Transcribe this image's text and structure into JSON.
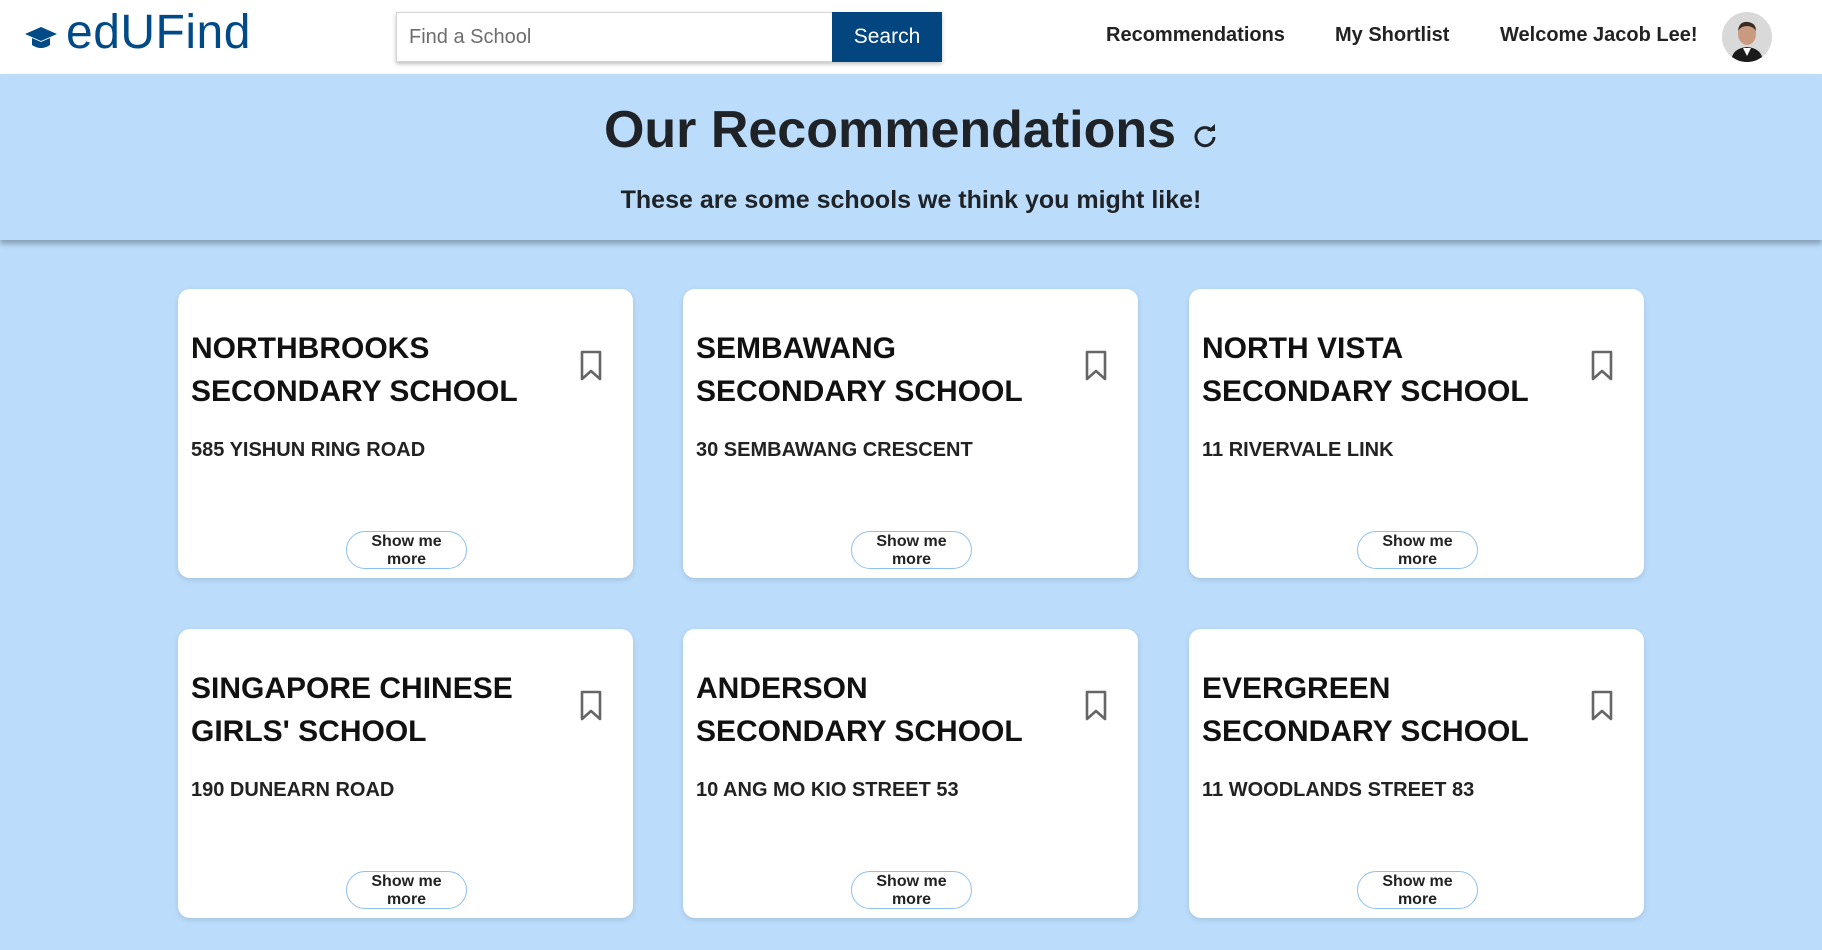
{
  "navbar": {
    "brand": "edUFind",
    "search": {
      "placeholder": "Find a School",
      "value": "",
      "button_label": "Search"
    },
    "links": {
      "recommendations": "Recommendations",
      "shortlist": "My Shortlist"
    },
    "welcome": "Welcome Jacob Lee!"
  },
  "hero": {
    "title": "Our Recommendations",
    "subtitle": "These are some schools we think you might like!"
  },
  "cards": [
    {
      "name": "NORTHBROOKS SECONDARY SCHOOL",
      "address": "585 YISHUN RING ROAD",
      "button": "Show me more"
    },
    {
      "name": "SEMBAWANG SECONDARY SCHOOL",
      "address": "30 SEMBAWANG CRESCENT",
      "button": "Show me more"
    },
    {
      "name": "NORTH VISTA SECONDARY SCHOOL",
      "address": "11 RIVERVALE LINK",
      "button": "Show me more"
    },
    {
      "name": "SINGAPORE CHINESE GIRLS' SCHOOL",
      "address": "190 DUNEARN ROAD",
      "button": "Show me more"
    },
    {
      "name": "ANDERSON SECONDARY SCHOOL",
      "address": "10 ANG MO KIO STREET 53",
      "button": "Show me more"
    },
    {
      "name": "EVERGREEN SECONDARY SCHOOL",
      "address": "11 WOODLANDS STREET 83",
      "button": "Show me more"
    }
  ],
  "icons": {
    "brand": "graduation-cap-icon",
    "refresh": "refresh-icon",
    "bookmark": "bookmark-icon"
  },
  "colors": {
    "brand": "#004b87",
    "search_button": "#03457e",
    "background": "#bbddfb",
    "card": "#ffffff",
    "button_border": "#8fc1ef"
  }
}
